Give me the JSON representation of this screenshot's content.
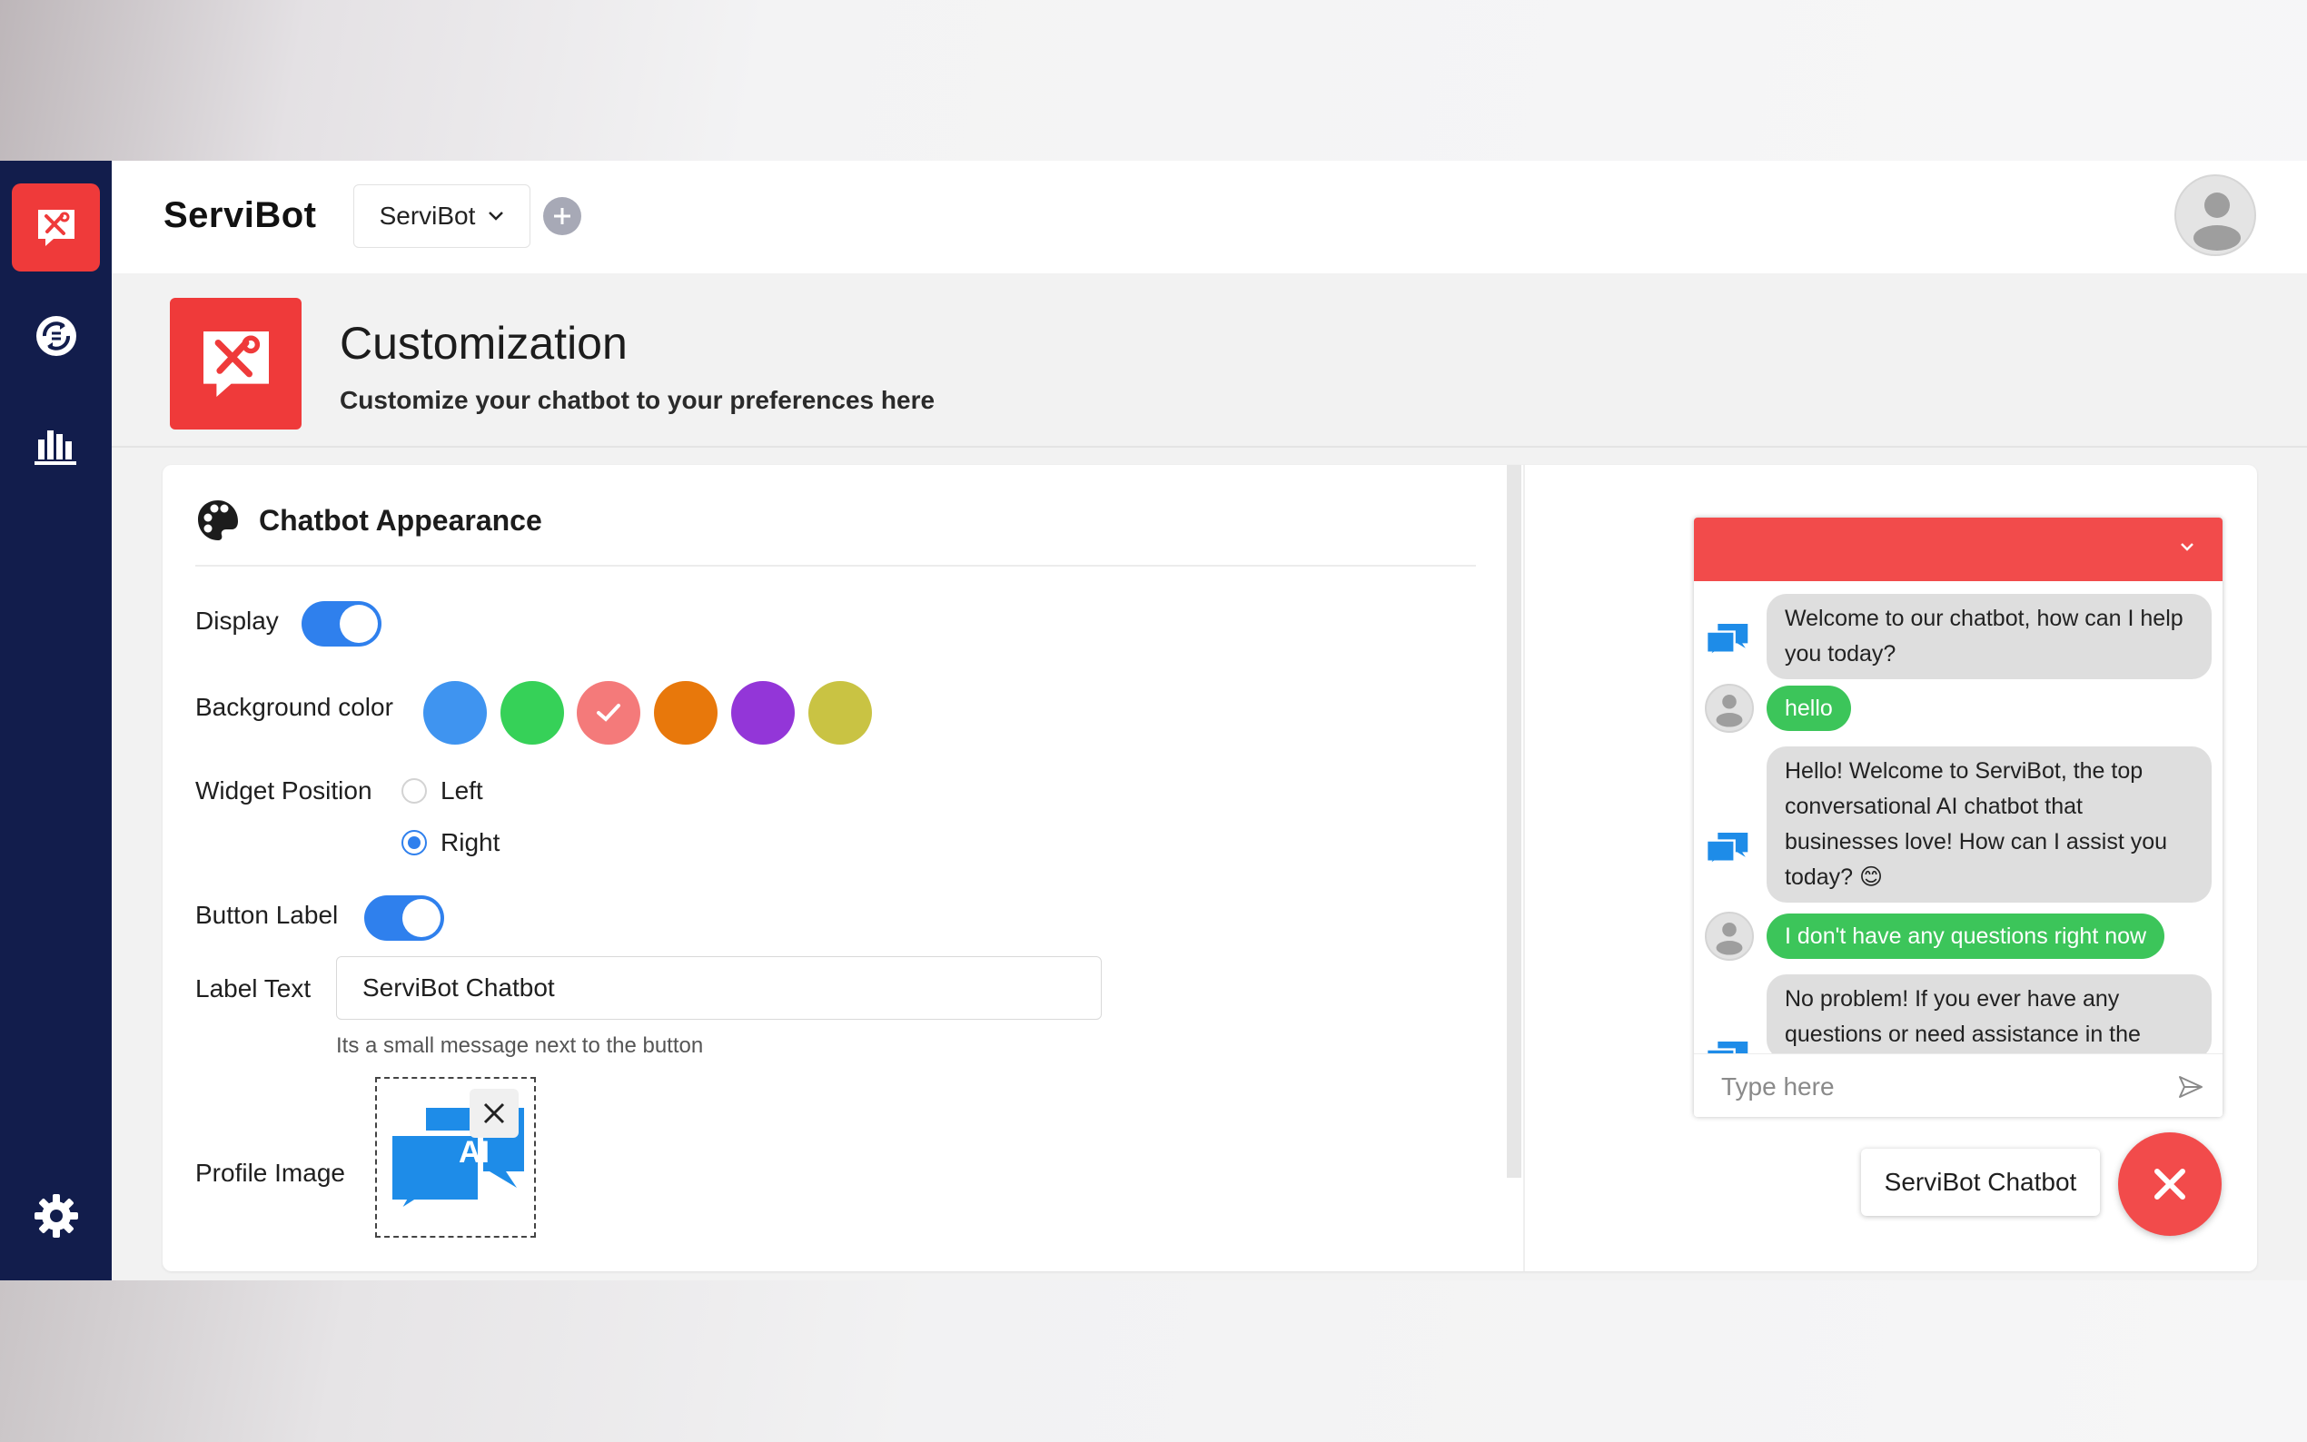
{
  "app": {
    "brand": "ServiBot",
    "bot_selector": "ServiBot"
  },
  "sidebar": {
    "items": [
      {
        "icon": "chatbot-tools-icon",
        "active": true
      },
      {
        "icon": "integrations-icon",
        "active": false
      },
      {
        "icon": "analytics-icon",
        "active": false
      },
      {
        "icon": "settings-icon",
        "active": false
      }
    ]
  },
  "page": {
    "title": "Customization",
    "subtitle": "Customize your chatbot to your preferences here"
  },
  "appearance": {
    "section_title": "Chatbot Appearance",
    "display_label": "Display",
    "display_on": true,
    "background_color_label": "Background color",
    "colors": [
      "#3f94f0",
      "#36d158",
      "#f47a7a",
      "#e8780b",
      "#9336d8",
      "#c9c343"
    ],
    "selected_color": "#f47a7a",
    "widget_position_label": "Widget Position",
    "position_options": [
      "Left",
      "Right"
    ],
    "position_selected": "Right",
    "button_label_label": "Button Label",
    "button_label_on": true,
    "label_text_label": "Label Text",
    "label_text_value": "ServiBot Chatbot",
    "label_text_hint": "Its a small message next to the button",
    "profile_image_label": "Profile Image"
  },
  "preview": {
    "header_color": "#f24b4b",
    "messages": [
      {
        "from": "bot",
        "text": "Welcome to our chatbot, how can I help you today?"
      },
      {
        "from": "user",
        "text": "hello"
      },
      {
        "from": "bot",
        "text": "Hello! Welcome to ServiBot, the top conversational AI chatbot that businesses love! How can I assist you today? 😊"
      },
      {
        "from": "user",
        "text": "I don't have any questions right now"
      },
      {
        "from": "bot",
        "text": "No problem! If you ever have any questions or need assistance in the"
      }
    ],
    "input_placeholder": "Type here",
    "launcher_label": "ServiBot Chatbot"
  }
}
